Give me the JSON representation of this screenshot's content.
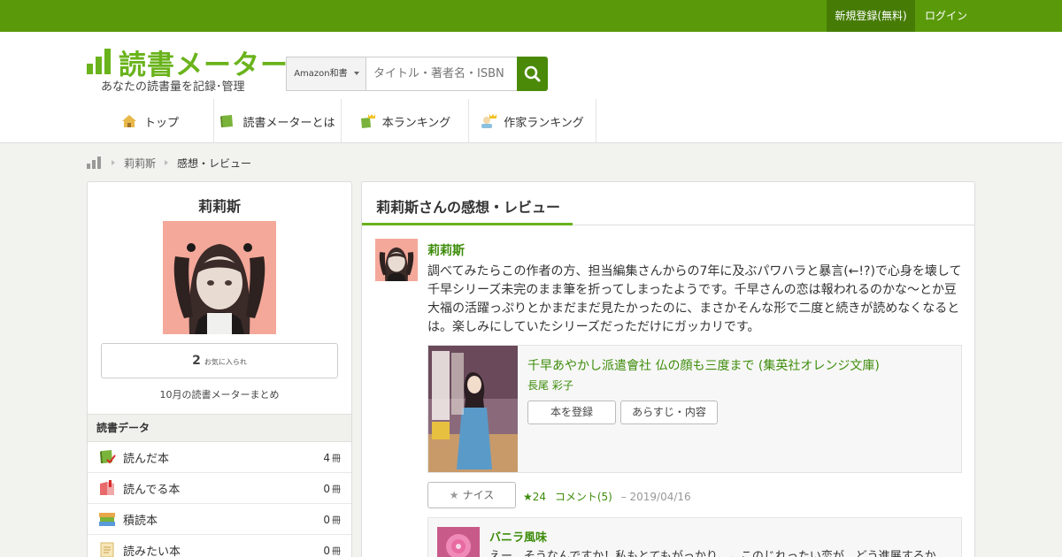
{
  "topbar": {
    "register": "新規登録(無料)",
    "login": "ログイン"
  },
  "logo": {
    "text": "読書メーター",
    "tagline": "あなたの読書量を記録･管理"
  },
  "search": {
    "category": "Amazon和書",
    "placeholder": "タイトル・著者名・ISBN"
  },
  "nav": [
    {
      "label": "トップ"
    },
    {
      "label": "読書メーターとは"
    },
    {
      "label": "本ランキング"
    },
    {
      "label": "作家ランキング"
    }
  ],
  "breadcrumb": {
    "user": "莉莉斯",
    "current": "感想・レビュー"
  },
  "profile": {
    "name": "莉莉斯",
    "favorites_count": "2",
    "favorites_label": "お気に入られ",
    "summary_link": "10月の読書メーターまとめ"
  },
  "reading_data": {
    "heading": "読書データ",
    "unit": "冊",
    "rows": [
      {
        "label": "読んだ本",
        "count": "4"
      },
      {
        "label": "読んでる本",
        "count": "0"
      },
      {
        "label": "積読本",
        "count": "0"
      },
      {
        "label": "読みたい本",
        "count": "0"
      }
    ]
  },
  "main": {
    "title": "莉莉斯さんの感想・レビュー",
    "review": {
      "user": "莉莉斯",
      "text": "調べてみたらこの作者の方、担当編集さんからの7年に及ぶパワハラと暴言(←!?)で心身を壊して千早シリーズ未完のまま筆を折ってしまったようです。千早さんの恋は報われるのかな〜とか豆大福の活躍っぷりとかまだまだ見たかったのに、まさかそんな形で二度と続きが読めなくなるとは。楽しみにしていたシリーズだっただけにガッカリです。",
      "book_title": "千早あやかし派遣會社 仏の顔も三度まで (集英社オレンジ文庫)",
      "book_author": "長尾 彩子",
      "register_button": "本を登録",
      "summary_button": "あらすじ・内容",
      "nice_button": "ナイス",
      "nice_count": "★24",
      "comment_link": "コメント(5)",
      "date": "2019/04/16"
    },
    "comment": {
      "user": "バニラ風味",
      "text": "えー、そうなんですか！私もとてもがっかり…。このじれったい恋が、どう進展するか"
    }
  },
  "colors": {
    "brand": "#5a9a0a",
    "link": "#3d8c0a"
  }
}
